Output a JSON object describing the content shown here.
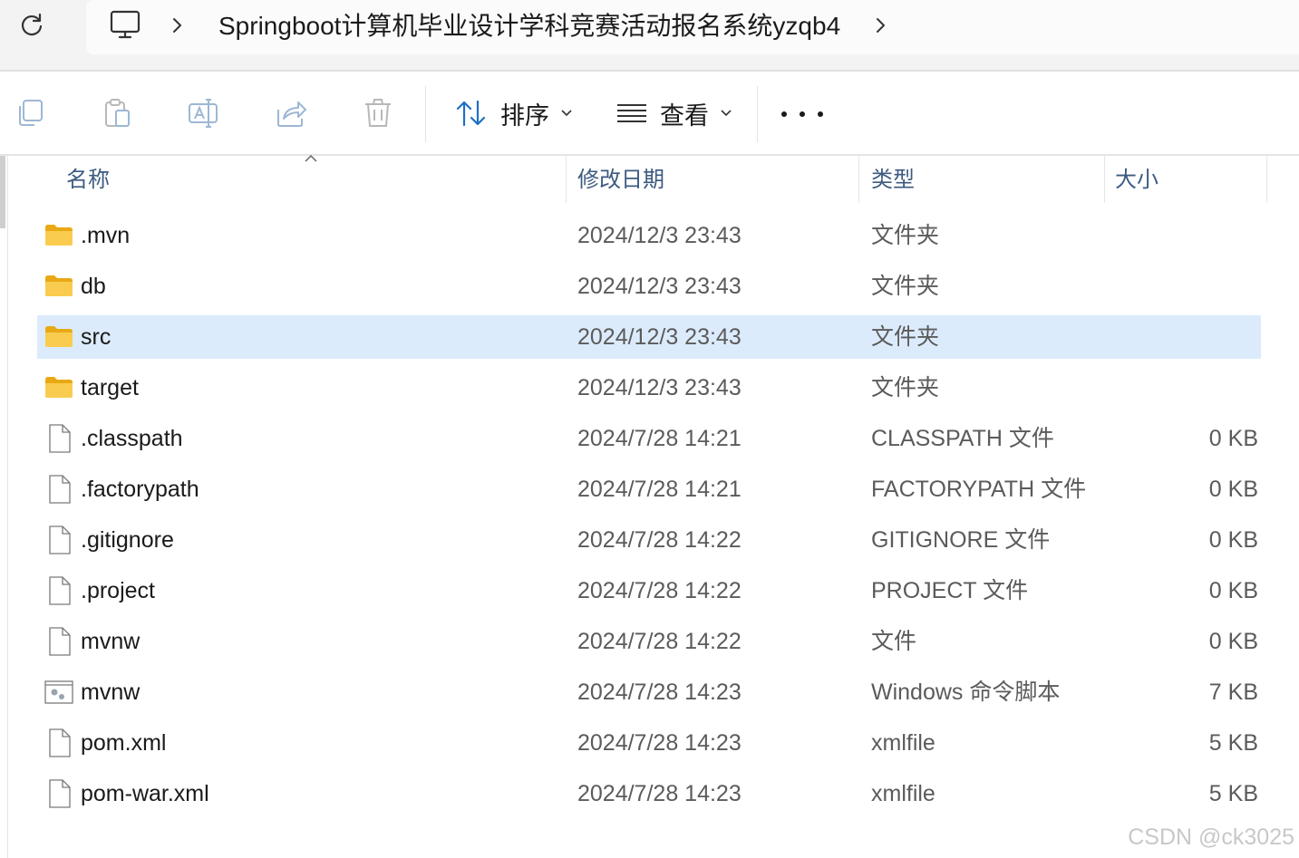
{
  "address": {
    "breadcrumb_path": "Springboot计算机毕业设计学科竞赛活动报名系统yzqb4"
  },
  "toolbar": {
    "sort_label": "排序",
    "view_label": "查看"
  },
  "columns": {
    "name": "名称",
    "modified": "修改日期",
    "type": "类型",
    "size": "大小"
  },
  "files": [
    {
      "name": ".mvn",
      "modified": "2024/12/3 23:43",
      "type": "文件夹",
      "size": "",
      "icon": "folder-icon"
    },
    {
      "name": "db",
      "modified": "2024/12/3 23:43",
      "type": "文件夹",
      "size": "",
      "icon": "folder-icon"
    },
    {
      "name": "src",
      "modified": "2024/12/3 23:43",
      "type": "文件夹",
      "size": "",
      "icon": "folder-icon",
      "selected": true
    },
    {
      "name": "target",
      "modified": "2024/12/3 23:43",
      "type": "文件夹",
      "size": "",
      "icon": "folder-icon"
    },
    {
      "name": ".classpath",
      "modified": "2024/7/28 14:21",
      "type": "CLASSPATH 文件",
      "size": "0 KB",
      "icon": "file-icon"
    },
    {
      "name": ".factorypath",
      "modified": "2024/7/28 14:21",
      "type": "FACTORYPATH 文件",
      "size": "0 KB",
      "icon": "file-icon"
    },
    {
      "name": ".gitignore",
      "modified": "2024/7/28 14:22",
      "type": "GITIGNORE 文件",
      "size": "0 KB",
      "icon": "file-icon"
    },
    {
      "name": ".project",
      "modified": "2024/7/28 14:22",
      "type": "PROJECT 文件",
      "size": "0 KB",
      "icon": "file-icon"
    },
    {
      "name": "mvnw",
      "modified": "2024/7/28 14:22",
      "type": "文件",
      "size": "0 KB",
      "icon": "file-icon"
    },
    {
      "name": "mvnw",
      "modified": "2024/7/28 14:23",
      "type": "Windows 命令脚本",
      "size": "7 KB",
      "icon": "script-icon"
    },
    {
      "name": "pom.xml",
      "modified": "2024/7/28 14:23",
      "type": "xmlfile",
      "size": "5 KB",
      "icon": "file-icon"
    },
    {
      "name": "pom-war.xml",
      "modified": "2024/7/28 14:23",
      "type": "xmlfile",
      "size": "5 KB",
      "icon": "file-icon"
    }
  ],
  "watermark": "CSDN @ck3025",
  "colors": {
    "selection": "#dcebfb",
    "header_text": "#3d5a80",
    "folder": "#f5c242"
  }
}
